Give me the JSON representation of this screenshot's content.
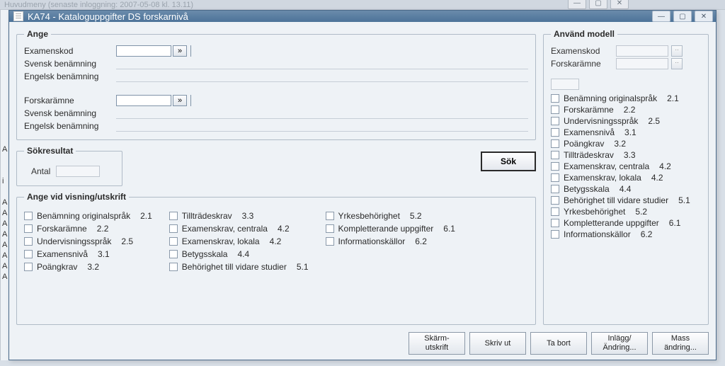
{
  "outer": {
    "title": "Huvudmeny    (senaste inloggning:  2007-05-08  kl. 13.11)"
  },
  "window": {
    "title": "KA74 - Kataloguppgifter DS forskarnivå"
  },
  "ange": {
    "legend": "Ange",
    "examenskod_label": "Examenskod",
    "svensk_label": "Svensk benämning",
    "engelsk_label": "Engelsk benämning",
    "forskaramne_label": "Forskarämne",
    "examenskod_value": "",
    "forskaramne_value": "",
    "pick_glyph": "»"
  },
  "sokresultat": {
    "legend": "Sökresultat",
    "antal_label": "Antal",
    "sok_label": "Sök"
  },
  "vis": {
    "legend": "Ange vid visning/utskrift",
    "col1": [
      {
        "label": "Benämning originalspråk",
        "num": "2.1"
      },
      {
        "label": "Forskarämne",
        "num": "2.2"
      },
      {
        "label": "Undervisningsspråk",
        "num": "2.5"
      },
      {
        "label": "Examensnivå",
        "num": "3.1"
      },
      {
        "label": "Poängkrav",
        "num": "3.2"
      }
    ],
    "col2": [
      {
        "label": "Tillträdeskrav",
        "num": "3.3"
      },
      {
        "label": "Examenskrav, centrala",
        "num": "4.2"
      },
      {
        "label": "Examenskrav, lokala",
        "num": "4.2"
      },
      {
        "label": "Betygsskala",
        "num": "4.4"
      },
      {
        "label": "Behörighet till vidare studier",
        "num": "5.1"
      }
    ],
    "col3": [
      {
        "label": "Yrkesbehörighet",
        "num": "5.2"
      },
      {
        "label": "Kompletterande uppgifter",
        "num": "6.1"
      },
      {
        "label": "Informationskällor",
        "num": "6.2"
      }
    ]
  },
  "modell": {
    "legend": "Använd modell",
    "examenskod_label": "Examenskod",
    "forskaramne_label": "Forskarämne",
    "items": [
      {
        "label": "Benämning originalspråk",
        "num": "2.1"
      },
      {
        "label": "Forskarämne",
        "num": "2.2"
      },
      {
        "label": "Undervisningsspråk",
        "num": "2.5"
      },
      {
        "label": "Examensnivå",
        "num": "3.1"
      },
      {
        "label": "Poängkrav",
        "num": "3.2"
      },
      {
        "label": "Tillträdeskrav",
        "num": "3.3"
      },
      {
        "label": "Examenskrav, centrala",
        "num": "4.2"
      },
      {
        "label": "Examenskrav, lokala",
        "num": "4.2"
      },
      {
        "label": "Betygsskala",
        "num": "4.4"
      },
      {
        "label": "Behörighet till vidare studier",
        "num": "5.1"
      },
      {
        "label": "Yrkesbehörighet",
        "num": "5.2"
      },
      {
        "label": "Kompletterande uppgifter",
        "num": "6.1"
      },
      {
        "label": "Informationskällor",
        "num": "6.2"
      }
    ]
  },
  "buttons": {
    "skarm": "Skärm-\nutskrift",
    "skriv": "Skriv ut",
    "tabort": "Ta bort",
    "inlagg": "Inlägg/\nÄndring...",
    "mass": "Mass\nändring..."
  },
  "left_strip": [
    "A",
    "",
    "",
    "i",
    "",
    "A",
    "A",
    "A",
    "A",
    "A",
    "A",
    "A",
    "A"
  ]
}
